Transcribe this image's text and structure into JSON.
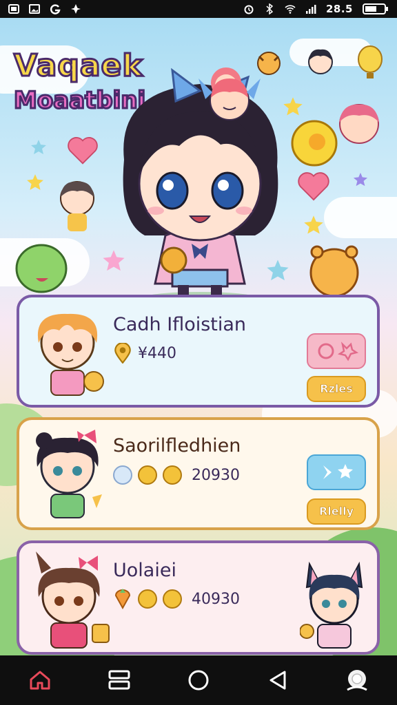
{
  "status_bar": {
    "time": "28.5",
    "icons": [
      "notification-icon",
      "gallery-icon",
      "g-icon",
      "drone-icon",
      "alarm-icon",
      "bluetooth-icon",
      "wifi-icon",
      "signal-icon",
      "battery-icon"
    ]
  },
  "logo": {
    "line1": "Vaqaek",
    "line2": "Moaatbini"
  },
  "cards": [
    {
      "name": "Cadh Ifloistian",
      "stat_icon": "location-pin-icon",
      "stat_value": "¥440",
      "icon_button": "heart-button",
      "action_label": "Rzles"
    },
    {
      "name": "Saorilfledhien",
      "stat_icons": [
        "ghost-icon",
        "coin-icon",
        "coin-icon"
      ],
      "stat_value": "20930",
      "icon_button": "star-button",
      "action_label": "Rlelly"
    },
    {
      "name": "Uolaiei",
      "stat_icons": [
        "carrot-icon",
        "coin-icon",
        "coin-icon"
      ],
      "stat_value": "40930"
    }
  ],
  "nav": [
    "home-icon",
    "recents-icon",
    "home-circle-icon",
    "back-icon",
    "assistant-icon"
  ],
  "colors": {
    "card_border_purple": "#7a5aa6",
    "card_border_gold": "#d8a24a",
    "logo_yellow": "#f7d74a",
    "logo_pink": "#e86cc2",
    "button_gold": "#f6c14a"
  }
}
